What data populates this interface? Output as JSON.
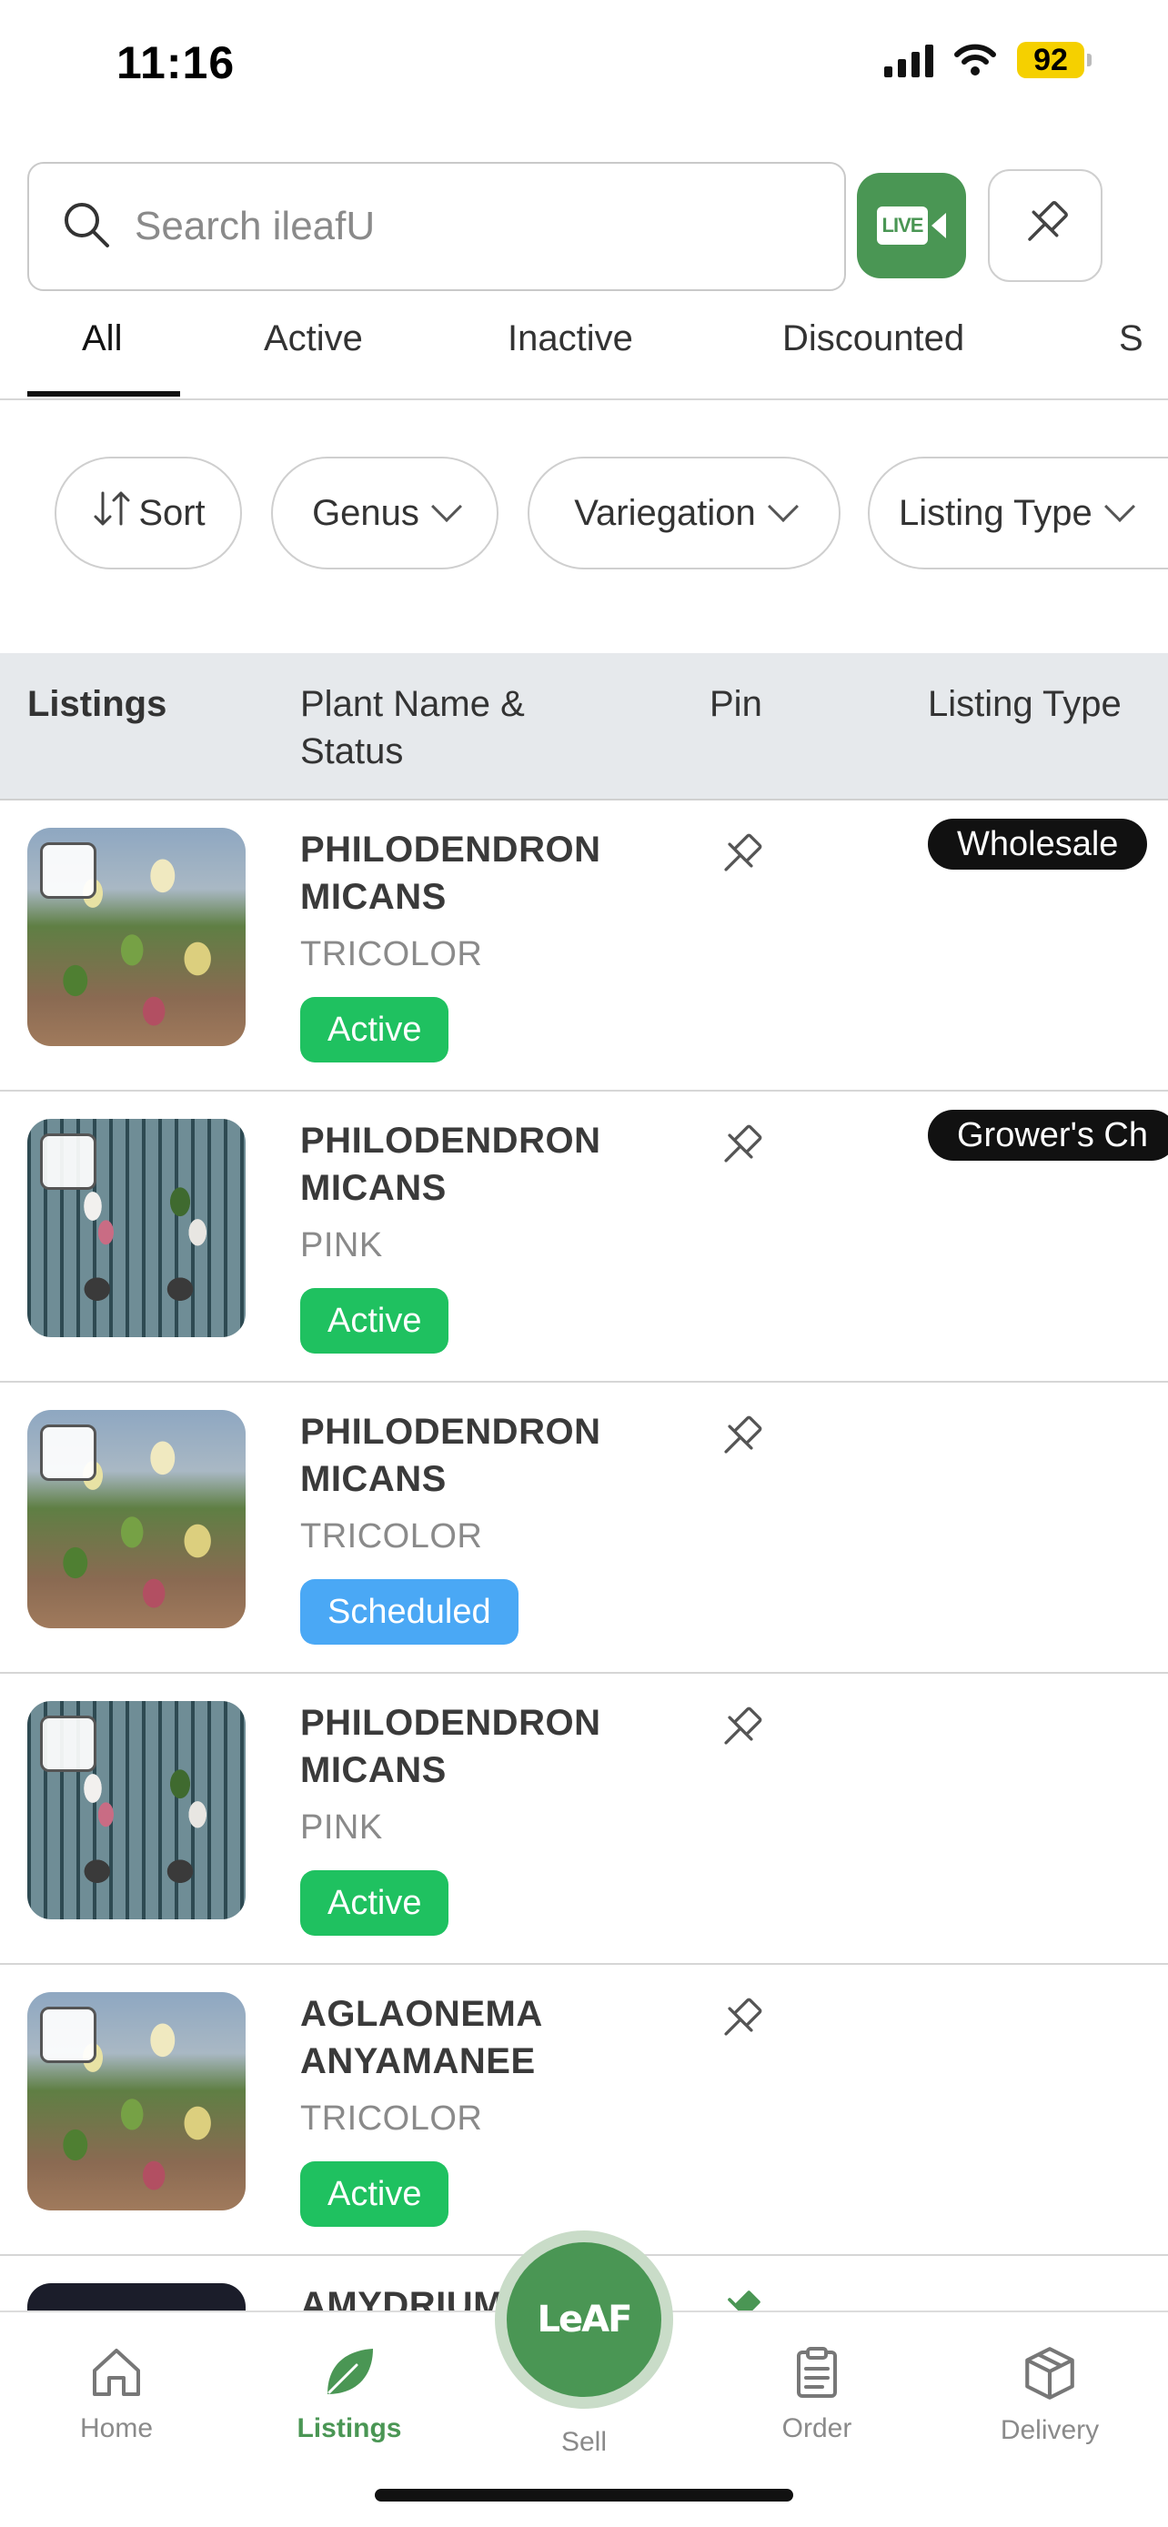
{
  "status_bar": {
    "time": "11:16",
    "battery": "92"
  },
  "search": {
    "placeholder": "Search ileafU"
  },
  "live_button": {
    "label": "LIVE"
  },
  "tabs": [
    {
      "label": "All",
      "active": true
    },
    {
      "label": "Active"
    },
    {
      "label": "Inactive"
    },
    {
      "label": "Discounted"
    },
    {
      "label": "S"
    }
  ],
  "filters": {
    "sort": "Sort",
    "genus": "Genus",
    "variegation": "Variegation",
    "listing_type": "Listing Type"
  },
  "table": {
    "headers": {
      "listings": "Listings",
      "plant_name_line1": "Plant Name &",
      "plant_name_line2": "Status",
      "pin": "Pin",
      "listing_type": "Listing Type"
    },
    "rows": [
      {
        "name_line1": "PHILODENDRON",
        "name_line2": "MICANS",
        "variety": "TRICOLOR",
        "status": "Active",
        "listing_type": "Wholesale"
      },
      {
        "name_line1": "PHILODENDRON",
        "name_line2": "MICANS",
        "variety": "PINK",
        "status": "Active",
        "listing_type": "Grower's Ch"
      },
      {
        "name_line1": "PHILODENDRON",
        "name_line2": "MICANS",
        "variety": "TRICOLOR",
        "status": "Scheduled",
        "listing_type": ""
      },
      {
        "name_line1": "PHILODENDRON",
        "name_line2": "MICANS",
        "variety": "PINK",
        "status": "Active",
        "listing_type": ""
      },
      {
        "name_line1": "AGLAONEMA",
        "name_line2": "ANYAMANEE",
        "variety": "TRICOLOR",
        "status": "Active",
        "listing_type": ""
      },
      {
        "name_line1": "AMYDRIUM",
        "name_line2": "",
        "variety": "",
        "status": "",
        "listing_type": ""
      }
    ]
  },
  "bottom_nav": {
    "home": "Home",
    "listings": "Listings",
    "sell": "Sell",
    "sell_logo": "LeAF",
    "order": "Order",
    "delivery": "Delivery"
  },
  "colors": {
    "brand_green": "#4a9654",
    "status_active": "#1fc160",
    "status_scheduled": "#4aa8f5",
    "battery": "#f5d000"
  }
}
